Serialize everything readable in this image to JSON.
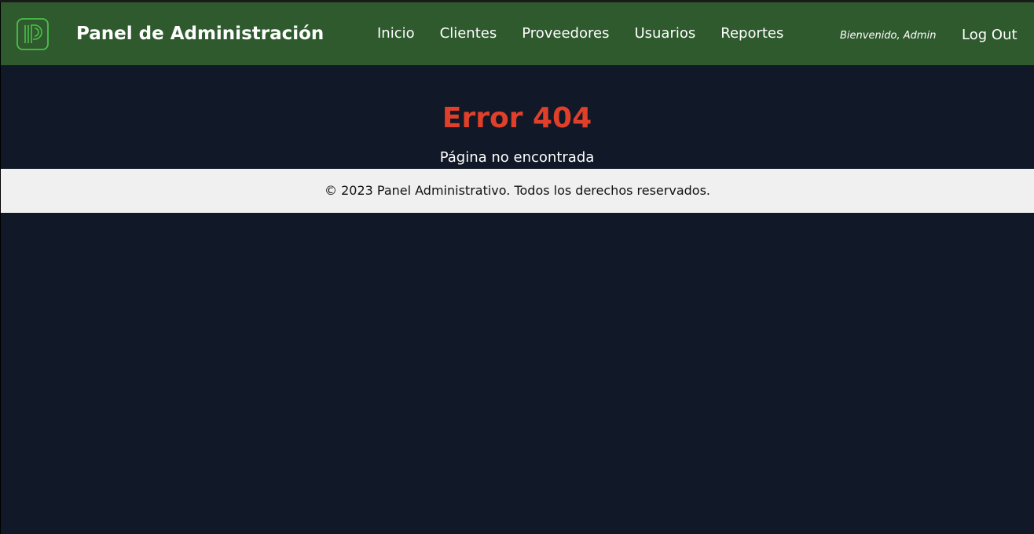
{
  "navbar": {
    "brand": "Panel de Administración",
    "logo_icon": "p-logo-icon",
    "links": [
      {
        "label": "Inicio"
      },
      {
        "label": "Clientes"
      },
      {
        "label": "Proveedores"
      },
      {
        "label": "Usuarios"
      },
      {
        "label": "Reportes"
      }
    ],
    "welcome": "Bienvenido, Admin",
    "logout": "Log Out"
  },
  "main": {
    "error_title": "Error 404",
    "error_message": "Página no encontrada"
  },
  "footer": {
    "text": "© 2023 Panel Administrativo. Todos los derechos reservados."
  },
  "colors": {
    "navbar_bg": "#2f5a2e",
    "page_bg": "#111827",
    "error_red": "#e0402a",
    "logo_green": "#4cc04a",
    "footer_bg": "#f0f0f0"
  }
}
